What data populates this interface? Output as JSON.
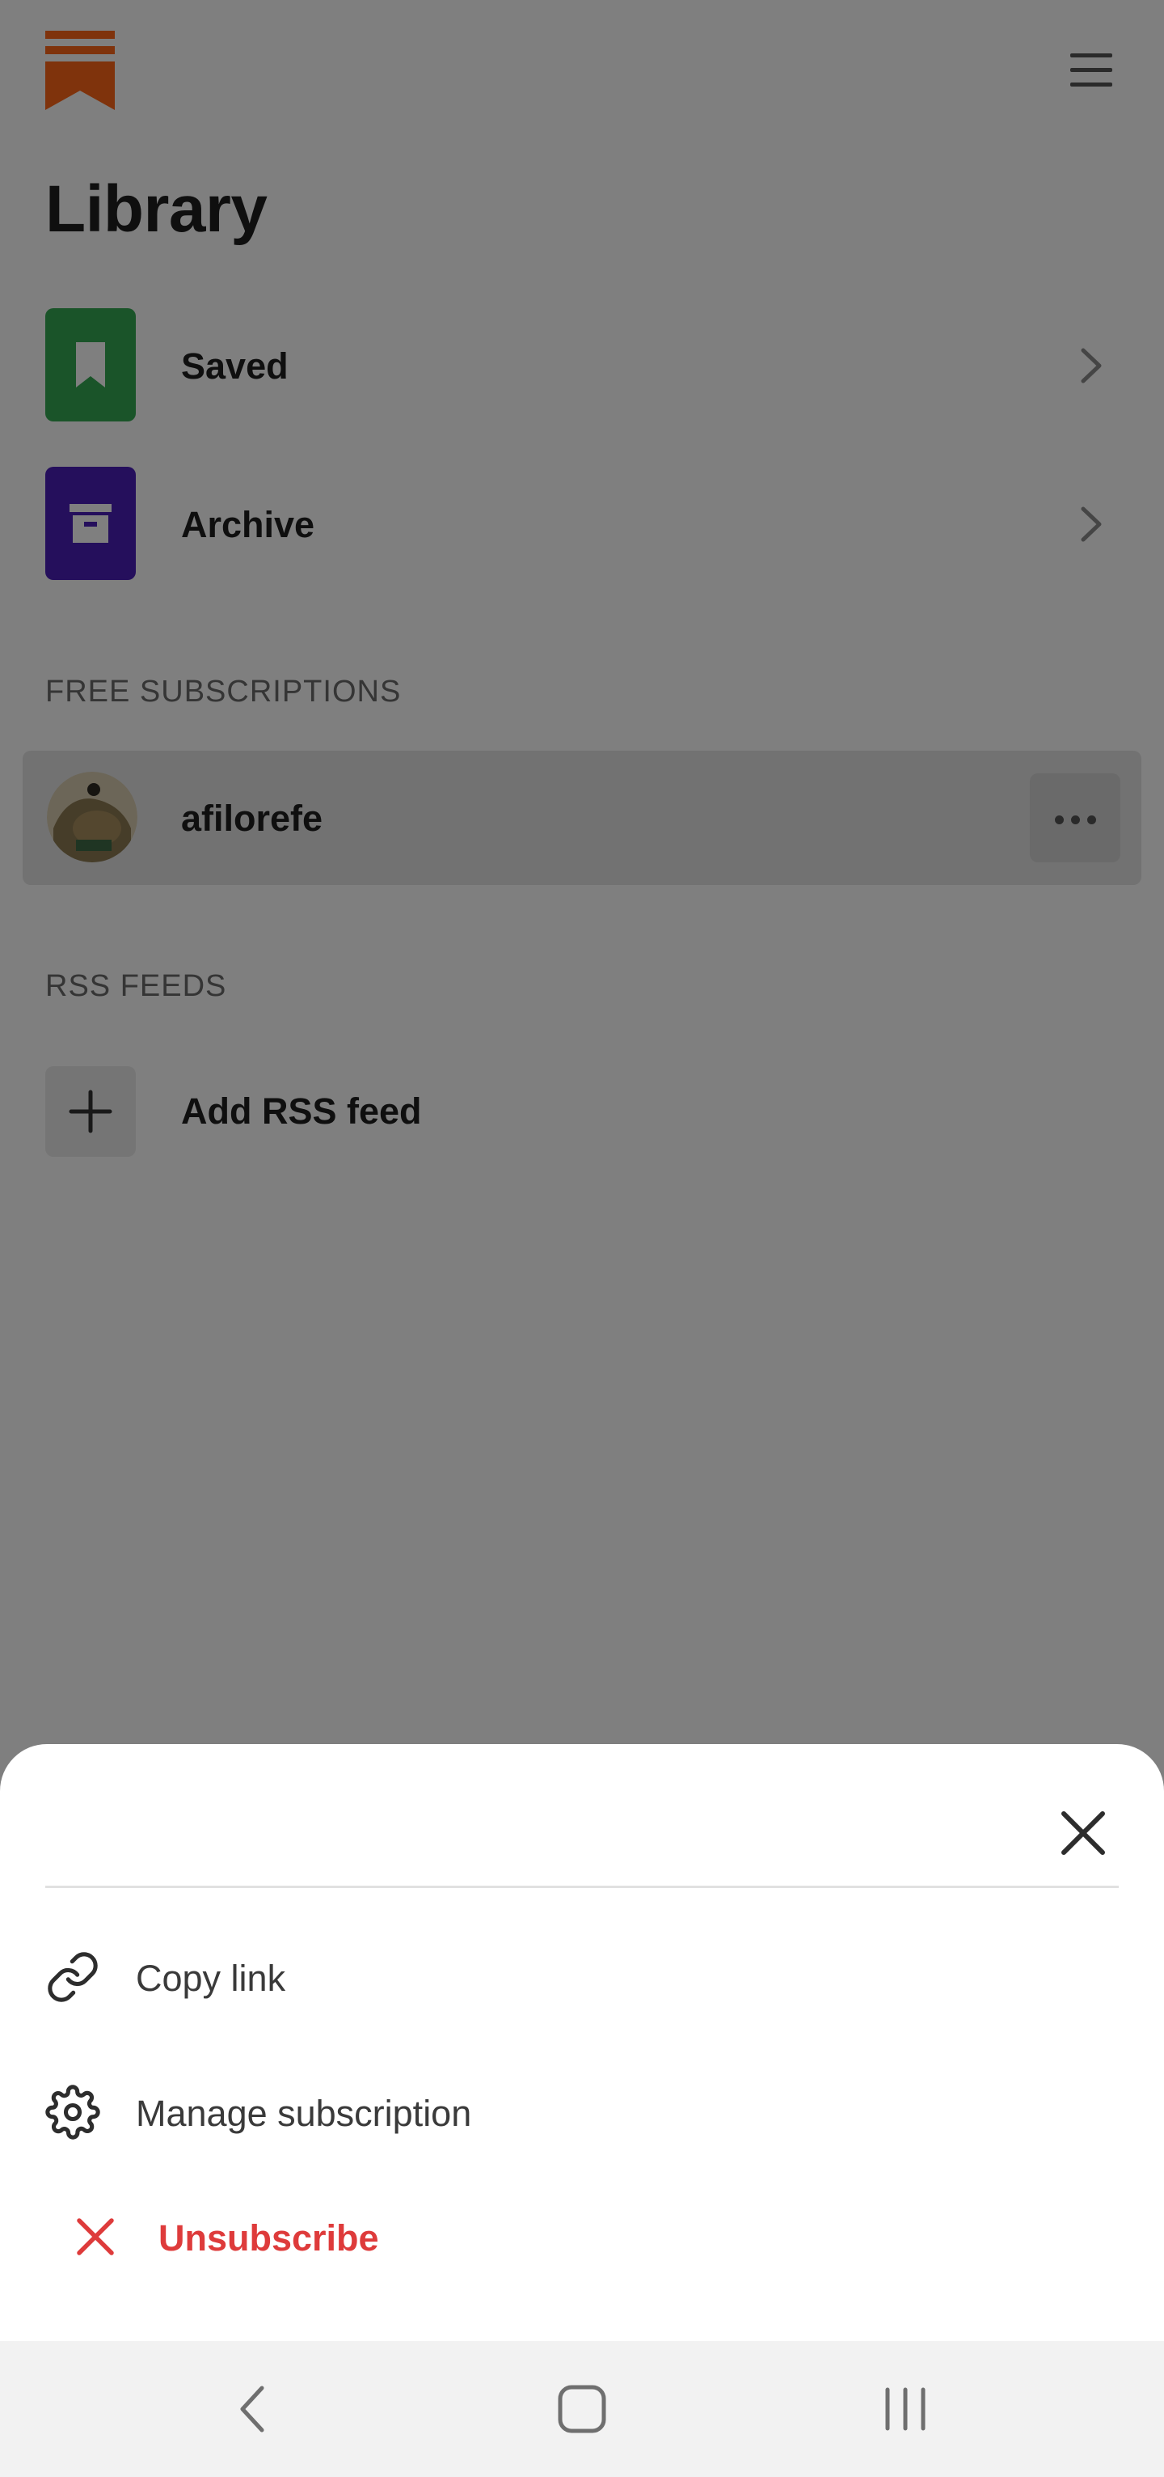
{
  "header": {
    "logo_icon": "bookmark-logo-icon",
    "menu_icon": "hamburger-menu-icon",
    "title": "Library"
  },
  "library_items": [
    {
      "label": "Saved",
      "icon": "bookmark-icon",
      "color": "#34a853"
    },
    {
      "label": "Archive",
      "icon": "archive-box-icon",
      "color": "#4a1fb8"
    }
  ],
  "free_subscriptions": {
    "heading": "FREE SUBSCRIPTIONS",
    "items": [
      {
        "name": "afilorefe",
        "more_icon": "ellipsis-icon"
      }
    ]
  },
  "rss_feeds": {
    "heading": "RSS FEEDS",
    "add_label": "Add RSS feed",
    "add_icon": "plus-icon"
  },
  "sheet": {
    "close_icon": "close-icon",
    "options": [
      {
        "label": "Copy link",
        "icon": "link-icon"
      },
      {
        "label": "Manage subscription",
        "icon": "gear-icon"
      },
      {
        "label": "Unsubscribe",
        "icon": "x-icon",
        "color": "#de3b3b"
      }
    ]
  },
  "system_nav": {
    "back_icon": "back-chevron-icon",
    "home_icon": "home-square-icon",
    "recents_icon": "recents-bars-icon"
  },
  "colors": {
    "brand": "#ff6719",
    "overlay": "rgba(0,0,0,0.5)",
    "danger": "#de3b3b"
  }
}
